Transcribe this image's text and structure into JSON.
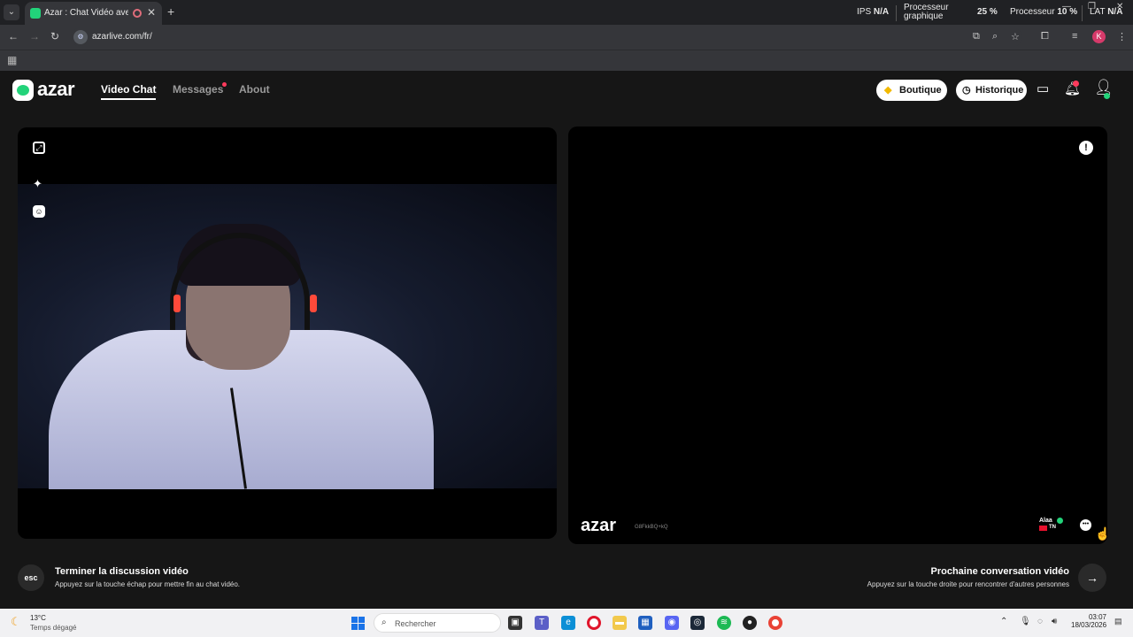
{
  "browser": {
    "tab_title": "Azar : Chat Vidéo avec de",
    "tab_close": "✕",
    "new_tab": "+",
    "url": "azarlive.com/fr/",
    "profile_initial": "K",
    "perf": {
      "ips_label": "IPS",
      "ips_value": "N/A",
      "gpu_label_line1": "Processeur",
      "gpu_label_line2": "graphique",
      "gpu_value": "25 %",
      "cpu_label": "Processeur",
      "cpu_value": "10 %",
      "lat_label": "LAT",
      "lat_value": "N/A"
    }
  },
  "header": {
    "logo": "azar",
    "nav": [
      "Video Chat",
      "Messages",
      "About"
    ],
    "boutique": "Boutique",
    "historique": "Historique"
  },
  "peer": {
    "watermark": "azar",
    "session_id": "G8FkkBQ+kQ",
    "name": "Alaa",
    "country": "TN"
  },
  "hints": {
    "esc_key": "esc",
    "end_title": "Terminer la discussion vidéo",
    "end_sub": "Appuyez sur la touche échap pour mettre fin au chat vidéo.",
    "next_title": "Prochaine conversation vidéo",
    "next_sub": "Appuyez sur la touche droite pour rencontrer d'autres personnes"
  },
  "taskbar": {
    "temperature": "13°C",
    "weather": "Temps dégagé",
    "search_placeholder": "Rechercher",
    "time": "03:07",
    "date": "18/03/2026"
  },
  "colors": {
    "accent": "#23d37a",
    "notification": "#ff3a5c",
    "background": "#161616"
  }
}
